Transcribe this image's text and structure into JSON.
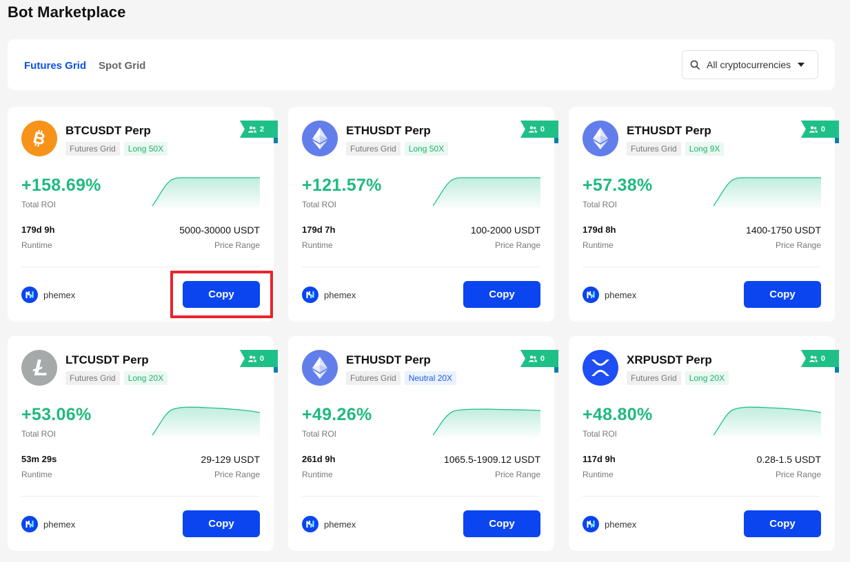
{
  "page": {
    "title": "Bot Marketplace"
  },
  "toolbar": {
    "tabs": [
      {
        "label": "Futures Grid",
        "active": true
      },
      {
        "label": "Spot Grid",
        "active": false
      }
    ],
    "filter": {
      "label": "All cryptocurrencies",
      "icon": "search-icon"
    }
  },
  "colors": {
    "accent": "#0a45f0",
    "roi_green": "#1fba7e",
    "ribbon": "#1fc088",
    "highlight": "#e8242c"
  },
  "labels": {
    "total_roi": "Total ROI",
    "runtime": "Runtime",
    "price_range": "Price Range",
    "copy": "Copy"
  },
  "cards": [
    {
      "pair": "BTCUSDT Perp",
      "coin_icon": "bitcoin-icon",
      "coin_color": "#f7931a",
      "tag1": "Futures Grid",
      "tag2": "Long 50X",
      "tag2_style": "green",
      "followers": "2",
      "roi": "+158.69%",
      "runtime": "179d 9h",
      "price_range": "5000-30000 USDT",
      "provider": "phemex",
      "highlighted": true,
      "spark": "plateau"
    },
    {
      "pair": "ETHUSDT Perp",
      "coin_icon": "ethereum-icon",
      "coin_color": "#627eea",
      "tag1": "Futures Grid",
      "tag2": "Long 50X",
      "tag2_style": "green",
      "followers": "0",
      "roi": "+121.57%",
      "runtime": "179d 7h",
      "price_range": "100-2000 USDT",
      "provider": "phemex",
      "highlighted": false,
      "spark": "plateau"
    },
    {
      "pair": "ETHUSDT Perp",
      "coin_icon": "ethereum-icon",
      "coin_color": "#627eea",
      "tag1": "Futures Grid",
      "tag2": "Long 9X",
      "tag2_style": "green",
      "followers": "0",
      "roi": "+57.38%",
      "runtime": "179d 8h",
      "price_range": "1400-1750 USDT",
      "provider": "phemex",
      "highlighted": false,
      "spark": "plateau"
    },
    {
      "pair": "LTCUSDT Perp",
      "coin_icon": "litecoin-icon",
      "coin_color": "#a6a9aa",
      "tag1": "Futures Grid",
      "tag2": "Long 20X",
      "tag2_style": "green",
      "followers": "0",
      "roi": "+53.06%",
      "runtime": "53m 29s",
      "price_range": "29-129 USDT",
      "provider": "phemex",
      "highlighted": false,
      "spark": "hump"
    },
    {
      "pair": "ETHUSDT Perp",
      "coin_icon": "ethereum-icon",
      "coin_color": "#627eea",
      "tag1": "Futures Grid",
      "tag2": "Neutral 20X",
      "tag2_style": "blue",
      "followers": "0",
      "roi": "+49.26%",
      "runtime": "261d 9h",
      "price_range": "1065.5-1909.12 USDT",
      "provider": "phemex",
      "highlighted": false,
      "spark": "plateau-flat"
    },
    {
      "pair": "XRPUSDT Perp",
      "coin_icon": "xrp-icon",
      "coin_color": "#1f4ef5",
      "tag1": "Futures Grid",
      "tag2": "Long 20X",
      "tag2_style": "green",
      "followers": "0",
      "roi": "+48.80%",
      "runtime": "117d 9h",
      "price_range": "0.28-1.5 USDT",
      "provider": "phemex",
      "highlighted": false,
      "spark": "hump"
    }
  ]
}
